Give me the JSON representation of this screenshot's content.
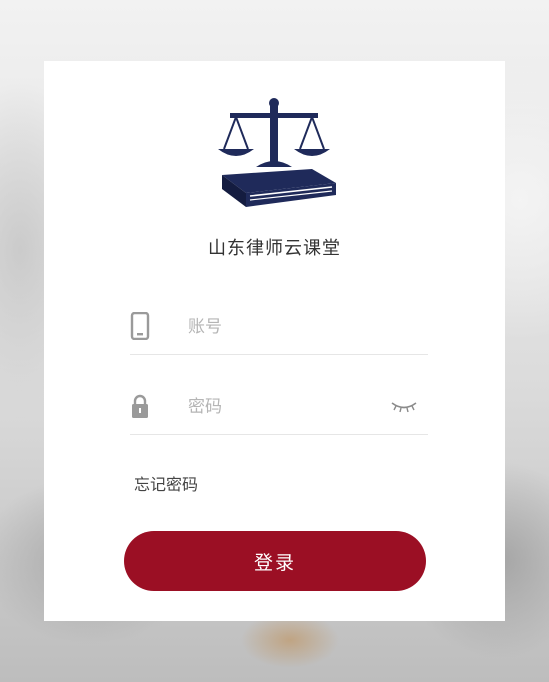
{
  "app": {
    "title": "山东律师云课堂"
  },
  "login": {
    "account_placeholder": "账号",
    "password_placeholder": "密码",
    "forgot_password_label": "忘记密码",
    "submit_label": "登录"
  },
  "icons": {
    "logo": "scales-of-justice-on-book-logo",
    "account": "phone-icon",
    "password": "lock-icon",
    "toggle_visibility": "eye-closed-icon"
  },
  "colors": {
    "brand_navy": "#1f2a5a",
    "button_red": "#9b0f24",
    "placeholder": "#b5b5b5"
  }
}
